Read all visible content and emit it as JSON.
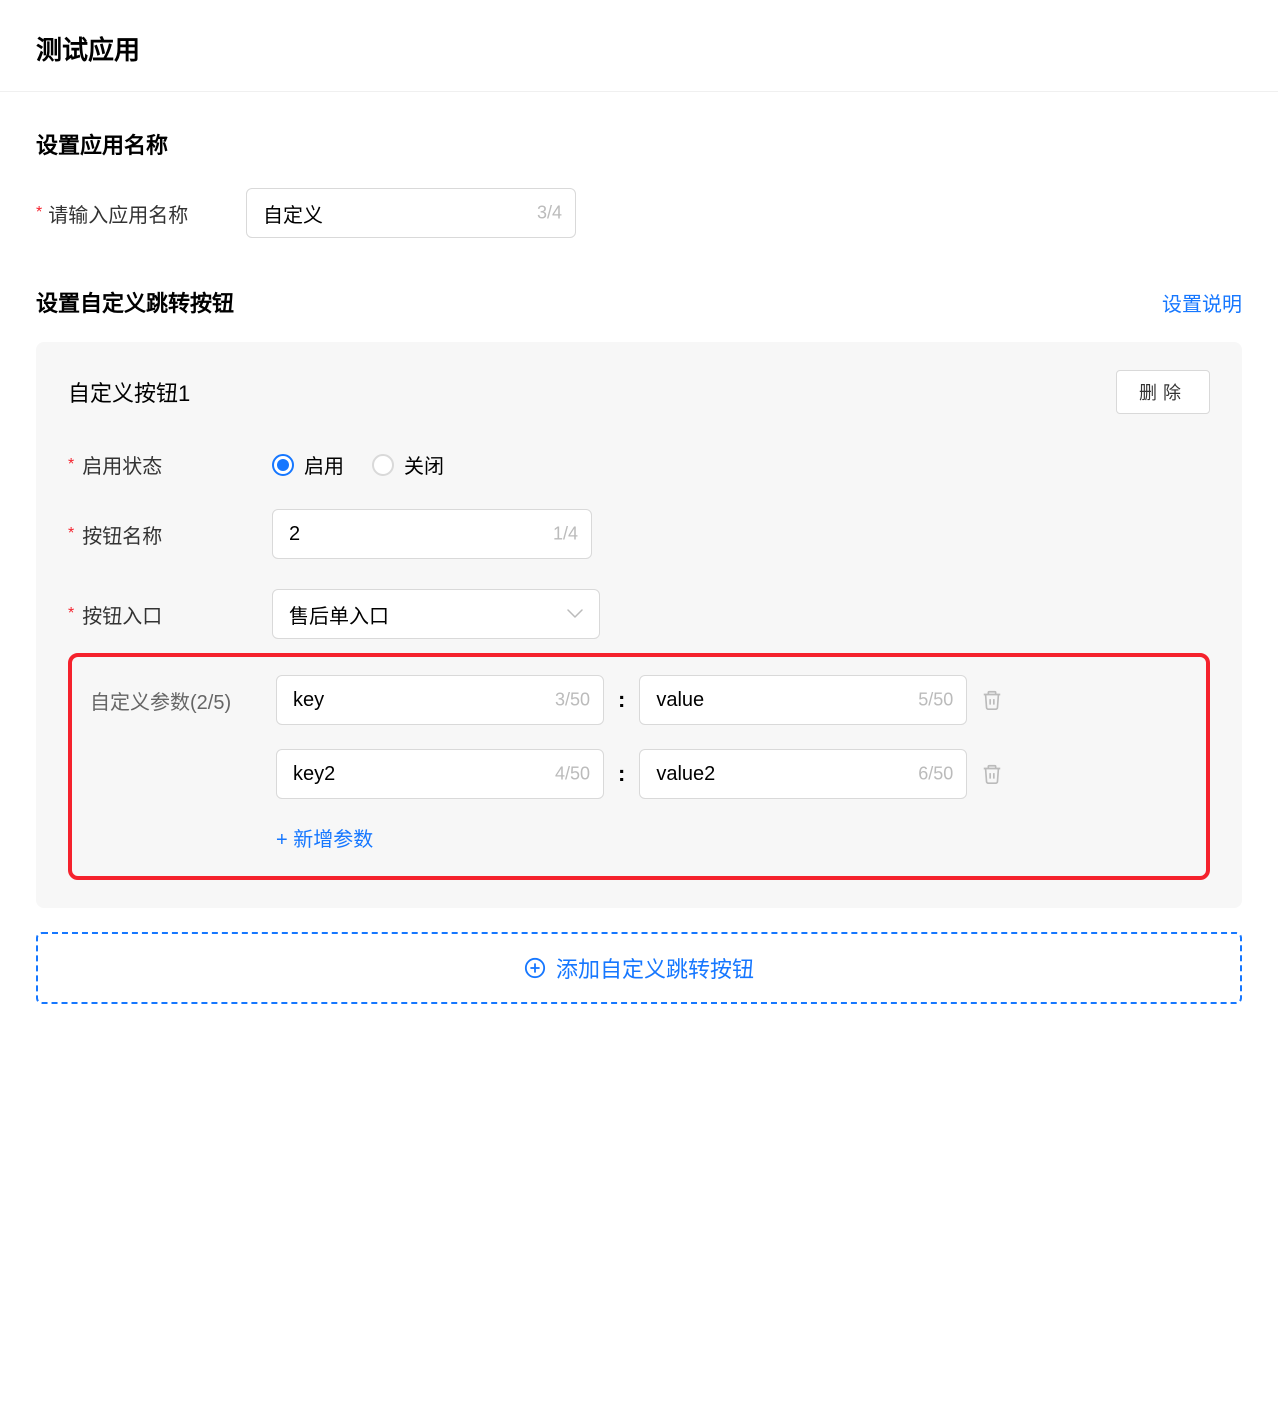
{
  "page": {
    "title": "测试应用"
  },
  "app_name": {
    "heading": "设置应用名称",
    "label": "请输入应用名称",
    "value": "自定义",
    "counter": "3/4"
  },
  "custom_buttons": {
    "heading": "设置自定义跳转按钮",
    "help_link": "设置说明",
    "panel1": {
      "title": "自定义按钮1",
      "delete_label": "删除",
      "enable_status": {
        "label": "启用状态",
        "enable_text": "启用",
        "disable_text": "关闭"
      },
      "button_name": {
        "label": "按钮名称",
        "value": "2",
        "counter": "1/4"
      },
      "button_entry": {
        "label": "按钮入口",
        "value": "售后单入口"
      },
      "params": {
        "label": "自定义参数(2/5)",
        "row1": {
          "key": "key",
          "key_counter": "3/50",
          "value": "value",
          "value_counter": "5/50"
        },
        "row2": {
          "key": "key2",
          "key_counter": "4/50",
          "value": "value2",
          "value_counter": "6/50"
        },
        "add_link": "+ 新增参数"
      }
    },
    "add_button_label": "添加自定义跳转按钮"
  }
}
